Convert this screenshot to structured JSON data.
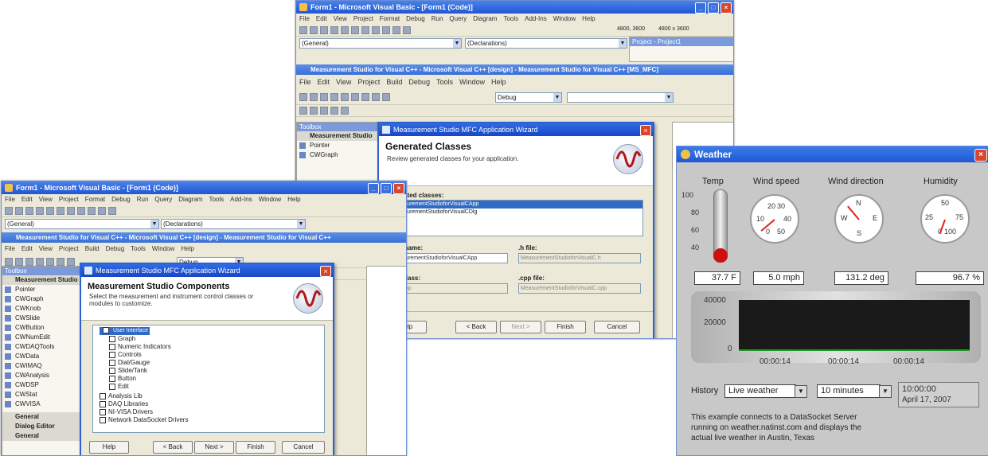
{
  "window_back": {
    "title": "Form1 - Microsoft Visual Basic - [Form1 (Code)]",
    "menu": [
      "File",
      "Edit",
      "View",
      "Project",
      "Format",
      "Debug",
      "Run",
      "Query",
      "Diagram",
      "Tools",
      "Add-Ins",
      "Window",
      "Help"
    ],
    "combo_left": "(General)",
    "combo_right": "(Declarations)",
    "coords": "4800, 3600",
    "size": "4800 x 3600",
    "project_panel": "Project - Project1",
    "inner_title": "Measurement Studio for Visual C++ - Microsoft Visual C++ [design] - Measurement Studio for Visual C++ [MS_MFC]",
    "inner_menu": [
      "File",
      "Edit",
      "View",
      "Project",
      "Build",
      "Debug",
      "Tools",
      "Window",
      "Help"
    ],
    "build_combo": "Debug",
    "toolbox_title": "Toolbox",
    "toolbox_section": "Measurement Studio",
    "toolbox_items": [
      "Pointer",
      "CWGraph"
    ],
    "dialog": {
      "title": "Measurement Studio MFC Application Wizard",
      "heading": "Generated Classes",
      "subtitle": "Review generated classes for your application.",
      "classes_label": "Generated classes:",
      "classes": [
        "CMeasurementStudioforVisualCApp",
        "CMeasurementStudioforVisualCDlg"
      ],
      "class_name_label": "Class name:",
      "class_name_value": "CMeasurementStudioforVisualCApp",
      "h_file_label": ".h file:",
      "h_file_value": "MeasurementStudioforVisualC.h",
      "base_class_label": "Base class:",
      "base_class_value": "CWinApp",
      "cpp_file_label": ".cpp file:",
      "cpp_file_value": "MeasurementStudioforVisualC.cpp",
      "buttons": [
        "Help",
        "< Back",
        "Next >",
        "Finish",
        "Cancel"
      ]
    }
  },
  "window_front": {
    "title": "Form1 - Microsoft Visual Basic - [Form1 (Code)]",
    "menu": [
      "File",
      "Edit",
      "View",
      "Project",
      "Format",
      "Debug",
      "Run",
      "Query",
      "Diagram",
      "Tools",
      "Add-Ins",
      "Window",
      "Help"
    ],
    "combo_left": "(General)",
    "combo_right": "(Declarations)",
    "inner_title": "Measurement Studio for Visual C++ - Microsoft Visual C++ [design] - Measurement Studio for Visual C++",
    "inner_menu": [
      "File",
      "Edit",
      "View",
      "Project",
      "Build",
      "Debug",
      "Tools",
      "Window",
      "Help"
    ],
    "build_combo": "Debug",
    "toolbox_title": "Toolbox",
    "toolbox_section": "Measurement Studio",
    "toolbox_items": [
      "Pointer",
      "CWGraph",
      "CWKnob",
      "CWSlide",
      "CWButton",
      "CWNumEdit",
      "CWDAQTools",
      "CWData",
      "CWIMAQ",
      "CWAnalysis",
      "CWDSP",
      "CWStat",
      "CWVISA"
    ],
    "toolbox_footer": [
      "General",
      "Dialog Editor",
      "General"
    ],
    "dialog": {
      "title": "Measurement Studio MFC Application Wizard",
      "heading": "Measurement Studio Components",
      "subtitle": "Select the measurement and instrument control classes or modules to customize.",
      "tree": [
        "User Interface",
        "Graph",
        "Numeric Indicators",
        "Controls",
        "Dial/Gauge",
        "Slide/Tank",
        "Button",
        "Edit",
        "Analysis Lib",
        "DAQ Libraries",
        "NI-VISA Drivers",
        "Network DataSocket Drivers"
      ],
      "buttons": [
        "Help",
        "< Back",
        "Next >",
        "Finish",
        "Cancel"
      ]
    }
  },
  "weather": {
    "title": "Weather",
    "labels": {
      "temp": "Temp",
      "wind_speed": "Wind speed",
      "wind_direction": "Wind direction",
      "humidity": "Humidity"
    },
    "temp_scale": [
      "100",
      "80",
      "60",
      "40"
    ],
    "wind_speed_ticks": [
      "20",
      "30",
      "10",
      "40",
      "0",
      "50"
    ],
    "compass": [
      "N",
      "W",
      "E",
      "S"
    ],
    "humidity_ticks": [
      "50",
      "25",
      "75",
      "0",
      "100"
    ],
    "values": {
      "temp": "37.7 F",
      "wind_speed": "5.0 mph",
      "wind_direction": "131.2 deg",
      "humidity": "96.7 %"
    },
    "chart_y_ticks": [
      "40000",
      "20000",
      "0"
    ],
    "chart_x_ticks": [
      "00:00:14",
      "00:00:14",
      "00:00:14"
    ],
    "history_label": "History",
    "history_source": "Live weather",
    "history_span": "10 minutes",
    "time": "10:00:00",
    "date": "April 17, 2007",
    "description": "This example connects to a DataSocket Server running on weather.natinst.com and displays the actual live weather in Austin, Texas",
    "colors": {
      "plot_bg": "#1a1a1a",
      "baseline": "#1d9a1d",
      "thermo": "#cc1010",
      "needle": "#e02020"
    }
  }
}
